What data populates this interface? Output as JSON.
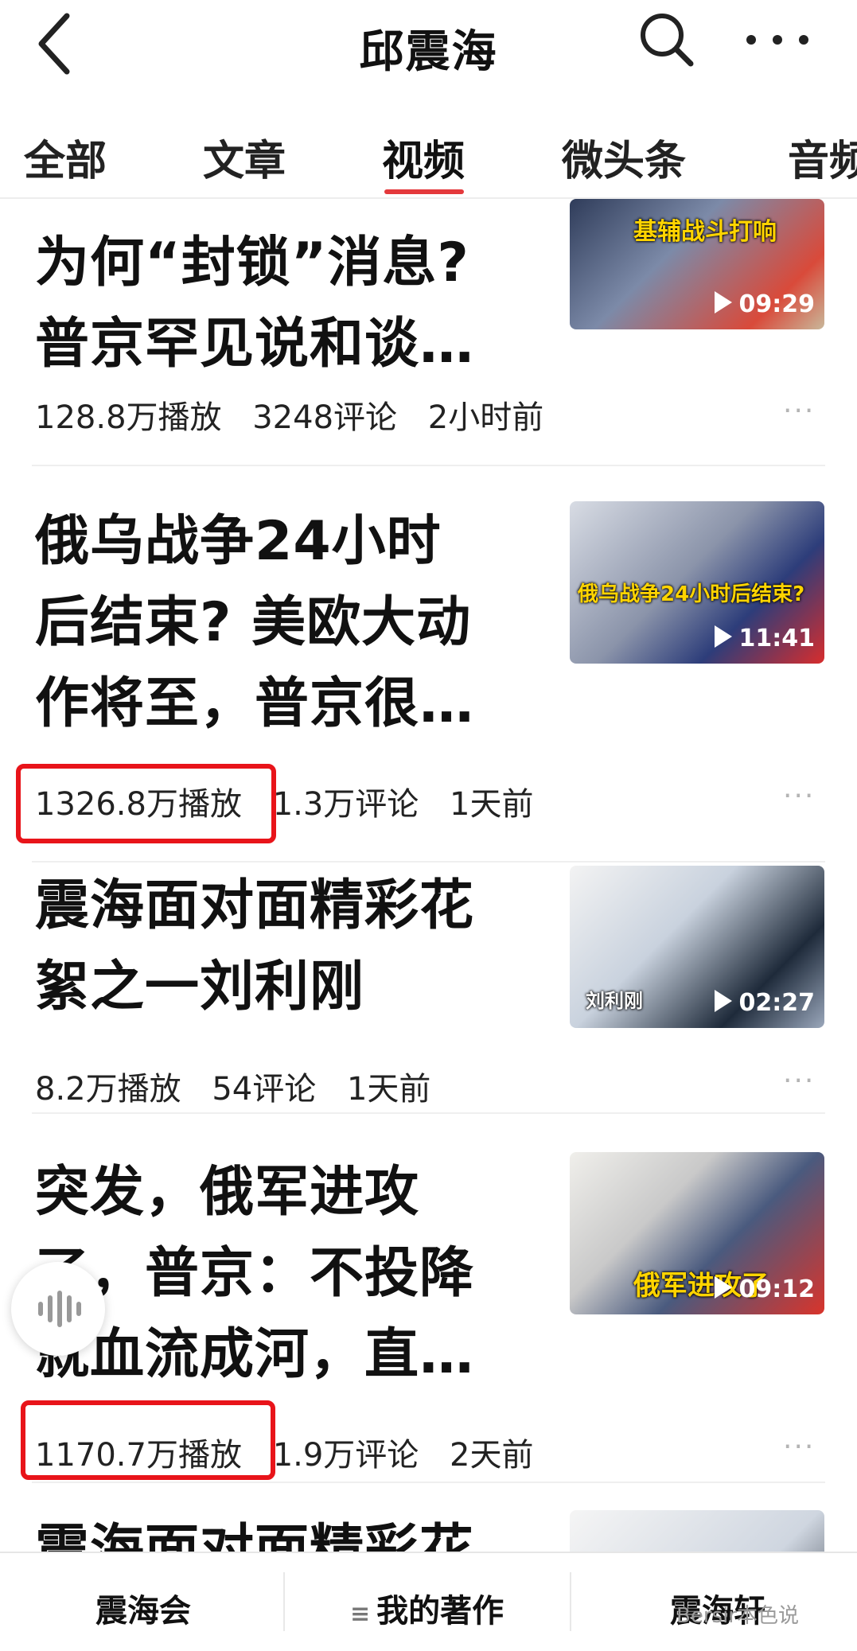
{
  "header": {
    "title": "邱震海"
  },
  "tabs": [
    {
      "label": "全部"
    },
    {
      "label": "文章"
    },
    {
      "label": "视频"
    },
    {
      "label": "微头条"
    },
    {
      "label": "音频"
    }
  ],
  "items": [
    {
      "title_lines": [
        "为何“封锁”消息?",
        "普京罕见说和谈…"
      ],
      "plays": "128.8万播放",
      "comments": "3248评论",
      "time": "2小时前",
      "duration": "09:29",
      "overlay": "基辅战斗打响"
    },
    {
      "title_lines": [
        "俄乌战争24小时",
        "后结束? 美欧大动",
        "作将至，普京很…"
      ],
      "plays": "1326.8万播放",
      "comments": "1.3万评论",
      "time": "1天前",
      "duration": "11:41",
      "overlay": "俄乌战争24小时后结束?"
    },
    {
      "title_lines": [
        "震海面对面精彩花",
        "絮之一刘利刚"
      ],
      "plays": "8.2万播放",
      "comments": "54评论",
      "time": "1天前",
      "duration": "02:27",
      "overlay": "刘利刚"
    },
    {
      "title_lines": [
        "突发，俄军进攻",
        "了，普京：不投降",
        "就血流成河，直…"
      ],
      "plays": "1170.7万播放",
      "comments": "1.9万评论",
      "time": "2天前",
      "duration": "09:12",
      "overlay": "俄军进攻了"
    },
    {
      "title_lines": [
        "震海面对面精彩花"
      ]
    }
  ],
  "bottom_bar": {
    "left": "震海会",
    "middle": "我的著作",
    "right": "震海轩"
  },
  "watermark": "Bersir本色说"
}
